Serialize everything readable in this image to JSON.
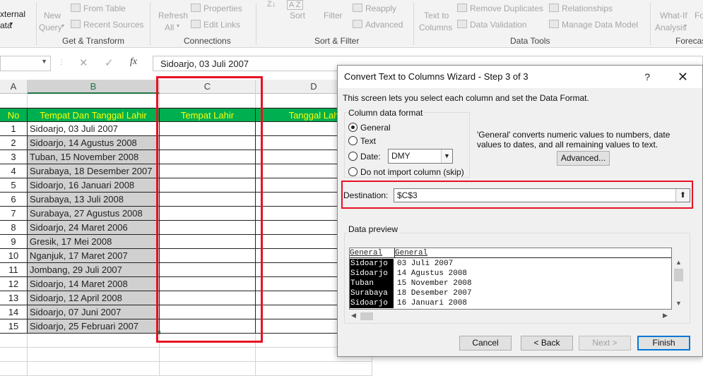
{
  "ribbon": {
    "external_label": "xternal",
    "external_label2": "ata",
    "new_query": "New",
    "new_query2": "Query",
    "from_table": "From Table",
    "recent_sources": "Recent Sources",
    "refresh": "Refresh",
    "refresh2": "All",
    "properties": "Properties",
    "edit_links": "Edit Links",
    "sort": "Sort",
    "filter": "Filter",
    "reapply": "Reapply",
    "advanced": "Advanced",
    "text_to_columns": "Text to",
    "text_to_columns2": "Columns",
    "remove_duplicates": "Remove Duplicates",
    "data_validation": "Data Validation",
    "relationships": "Relationships",
    "manage_data_model": "Manage Data Model",
    "what_if": "What-If",
    "what_if2": "Analysis",
    "fo": "Fo",
    "groups": {
      "get_transform": "Get & Transform",
      "connections": "Connections",
      "sort_filter": "Sort & Filter",
      "data_tools": "Data Tools",
      "forecast": "Forecas"
    }
  },
  "formula_bar": {
    "cancel": "✕",
    "enter": "✓",
    "fx": "fx",
    "value": "Sidoarjo, 03 Juli 2007"
  },
  "columns": {
    "a": "A",
    "b": "B",
    "c": "C",
    "d": "D"
  },
  "table": {
    "headers": {
      "no": "No",
      "tempat_tanggal": "Tempat Dan Tanggal Lahir",
      "tempat": "Tempat Lahir",
      "tanggal": "Tanggal Lah"
    },
    "rows": [
      {
        "no": "1",
        "value": "Sidoarjo, 03 Juli 2007"
      },
      {
        "no": "2",
        "value": "Sidoarjo, 14 Agustus 2008"
      },
      {
        "no": "3",
        "value": "Tuban, 15 November 2008"
      },
      {
        "no": "4",
        "value": "Surabaya, 18 Desember 2007"
      },
      {
        "no": "5",
        "value": "Sidoarjo, 16 Januari 2008"
      },
      {
        "no": "6",
        "value": "Surabaya, 13 Juli 2008"
      },
      {
        "no": "7",
        "value": "Surabaya, 27 Agustus 2008"
      },
      {
        "no": "8",
        "value": "Sidoarjo, 24 Maret 2006"
      },
      {
        "no": "9",
        "value": "Gresik, 17 Mei 2008"
      },
      {
        "no": "10",
        "value": "Nganjuk, 17 Maret 2007"
      },
      {
        "no": "11",
        "value": "Jombang, 29 Juli 2007"
      },
      {
        "no": "12",
        "value": "Sidoarjo, 14 Maret 2008"
      },
      {
        "no": "13",
        "value": "Sidoarjo, 12 April 2008"
      },
      {
        "no": "14",
        "value": "Sidoarjo, 07 Juni 2007"
      },
      {
        "no": "15",
        "value": "Sidoarjo, 25 Februari 2007"
      }
    ]
  },
  "dialog": {
    "title": "Convert Text to Columns Wizard - Step 3 of 3",
    "help": "?",
    "close": "✕",
    "description": "This screen lets you select each column and set the Data Format.",
    "column_format_legend": "Column data format",
    "options": {
      "general": "General",
      "text": "Text",
      "date": "Date:",
      "skip": "Do not import column (skip)"
    },
    "date_format": "DMY",
    "info": "'General' converts numeric values to numbers, date values to dates, and all remaining values to text.",
    "advanced_button": "Advanced...",
    "destination_label": "Destination:",
    "destination_value": "$C$3",
    "preview_legend": "Data preview",
    "preview_headers": [
      "General",
      "General"
    ],
    "preview_col1": [
      "Sidoarjo",
      "Sidoarjo",
      "Tuban",
      "Surabaya",
      "Sidoarjo"
    ],
    "preview_col2": [
      "03 Juli 2007",
      "14 Agustus 2008",
      "15 November 2008",
      "18 Desember 2007",
      "16 Januari 2008"
    ],
    "buttons": {
      "cancel": "Cancel",
      "back": "< Back",
      "next": "Next >",
      "finish": "Finish"
    }
  }
}
